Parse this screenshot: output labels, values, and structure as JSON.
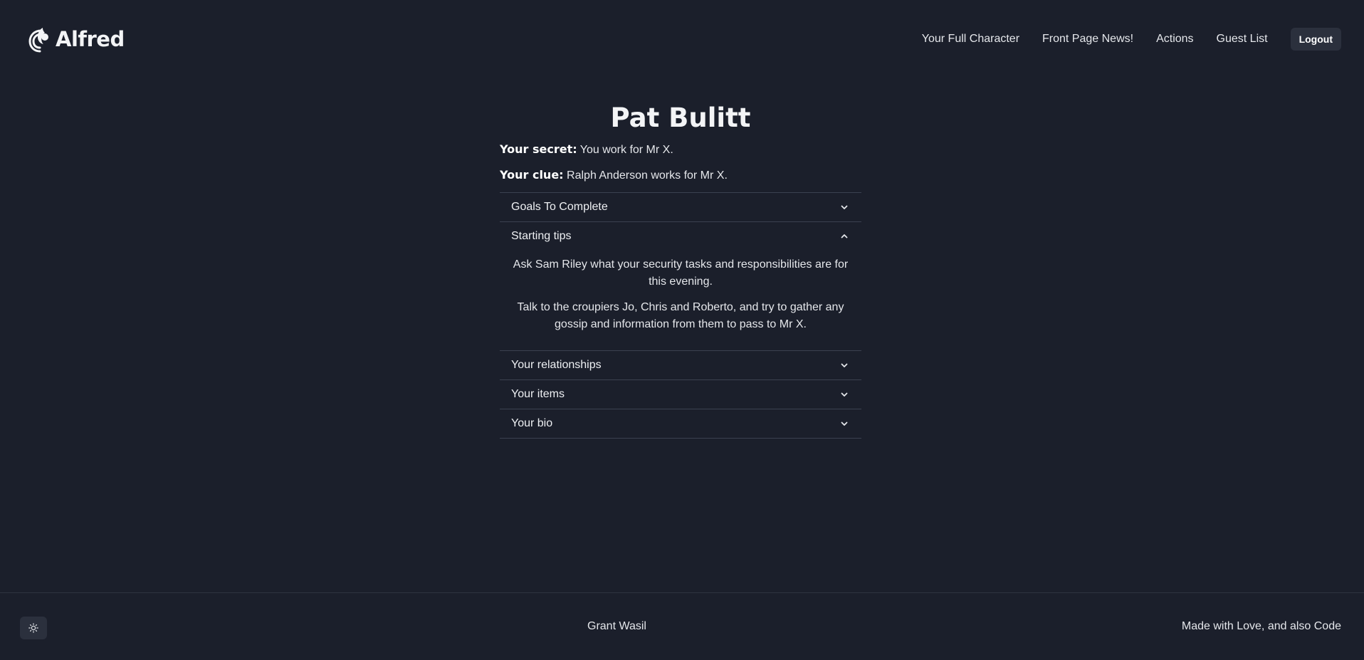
{
  "header": {
    "brand": "Alfred",
    "nav": [
      "Your Full Character",
      "Front Page News!",
      "Actions",
      "Guest List"
    ],
    "logout_label": "Logout"
  },
  "character": {
    "name": "Pat Bulitt",
    "secret_label": "Your secret:",
    "secret": "You work for Mr X.",
    "clue_label": "Your clue:",
    "clue": "Ralph Anderson works for Mr X."
  },
  "sections": [
    {
      "title": "Goals To Complete",
      "expanded": false
    },
    {
      "title": "Starting tips",
      "expanded": true,
      "paragraphs": [
        "Ask Sam Riley what your security tasks and responsibilities are for this evening.",
        "Talk to the croupiers Jo, Chris and Roberto, and try to gather any gossip and information from them to pass to Mr X."
      ]
    },
    {
      "title": "Your relationships",
      "expanded": false
    },
    {
      "title": "Your items",
      "expanded": false
    },
    {
      "title": "Your bio",
      "expanded": false
    }
  ],
  "footer": {
    "center": "Grant Wasil",
    "right": "Made with Love, and also Code",
    "theme_icon": "sun-icon"
  },
  "colors": {
    "background": "#1b1f2b",
    "button_bg": "#2b303d",
    "divider": "#3b4150"
  }
}
